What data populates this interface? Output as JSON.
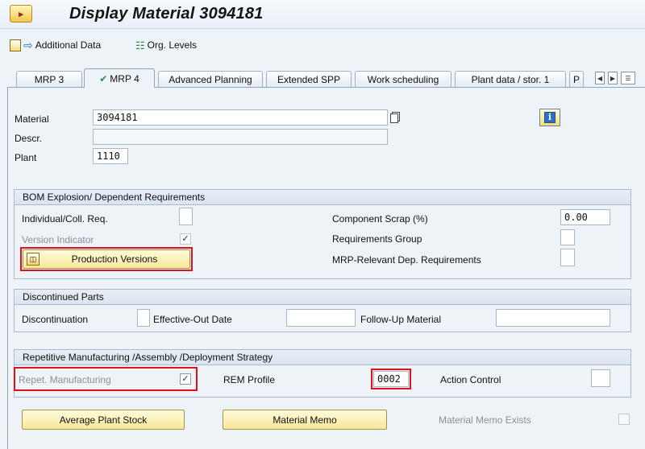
{
  "window": {
    "title": "Display Material 3094181",
    "app_icon": "sap-icon"
  },
  "toolbar": {
    "additional_data": "Additional Data",
    "org_levels": "Org. Levels"
  },
  "tabs": [
    {
      "label": "MRP 3"
    },
    {
      "label": "MRP 4",
      "active": true
    },
    {
      "label": "Advanced Planning"
    },
    {
      "label": "Extended SPP"
    },
    {
      "label": "Work scheduling"
    },
    {
      "label": "Plant data / stor. 1"
    },
    {
      "label": "P"
    }
  ],
  "header": {
    "material_label": "Material",
    "material_value": "3094181",
    "descr_label": "Descr.",
    "descr_value": "",
    "plant_label": "Plant",
    "plant_value": "1110"
  },
  "bom": {
    "title": "BOM Explosion/ Dependent Requirements",
    "individual_label": "Individual/Coll. Req.",
    "version_indicator_label": "Version Indicator",
    "version_indicator_checked": "✓",
    "production_versions_label": "Production Versions",
    "component_scrap_label": "Component Scrap (%)",
    "component_scrap_value": "0.00",
    "requirements_group_label": "Requirements Group",
    "mrp_relevant_label": "MRP-Relevant Dep. Requirements"
  },
  "discontinued": {
    "title": "Discontinued Parts",
    "discontinuation_label": "Discontinuation",
    "effective_out_label": "Effective-Out Date",
    "follow_up_label": "Follow-Up Material"
  },
  "repetitive": {
    "title": "Repetitive Manufacturing /Assembly /Deployment Strategy",
    "repet_label": "Repet. Manufacturing",
    "repet_checked": "✓",
    "rem_profile_label": "REM Profile",
    "rem_profile_value": "0002",
    "action_control_label": "Action Control"
  },
  "footer": {
    "average_plant_stock": "Average Plant Stock",
    "material_memo": "Material Memo",
    "memo_exists_label": "Material Memo Exists"
  },
  "colors": {
    "highlight": "#e3101a",
    "button_yellow": "#f7e89a",
    "background": "#eef3f8"
  }
}
